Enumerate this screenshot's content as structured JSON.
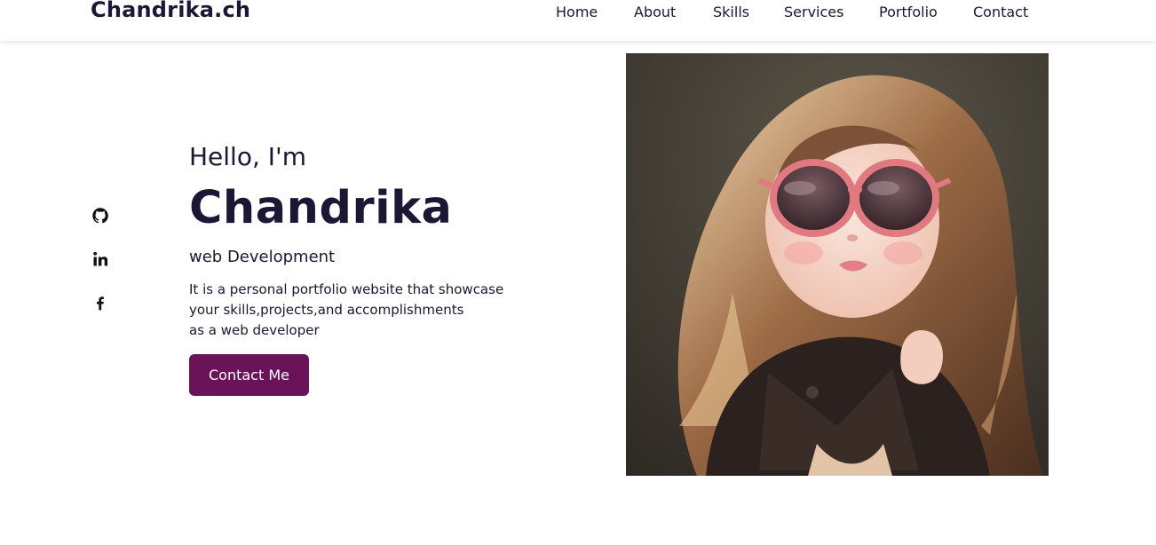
{
  "header": {
    "logo": "Chandrika.ch",
    "nav": [
      {
        "label": "Home"
      },
      {
        "label": "About"
      },
      {
        "label": "Skills"
      },
      {
        "label": "Services"
      },
      {
        "label": "Portfolio"
      },
      {
        "label": "Contact"
      }
    ]
  },
  "social": [
    {
      "icon": "github-icon"
    },
    {
      "icon": "linkedin-icon"
    },
    {
      "icon": "facebook-icon"
    }
  ],
  "hero": {
    "greeting": "Hello, I'm",
    "name": "Chandrika",
    "role": "web Development",
    "description": [
      "It is a personal portfolio website that showcase",
      "your skills,projects,and accomplishments",
      "as a web developer"
    ],
    "cta_label": "Contact Me"
  },
  "colors": {
    "text": "#1b1735",
    "button": "#6b1358",
    "button_text": "#ffffff",
    "background": "#ffffff"
  }
}
